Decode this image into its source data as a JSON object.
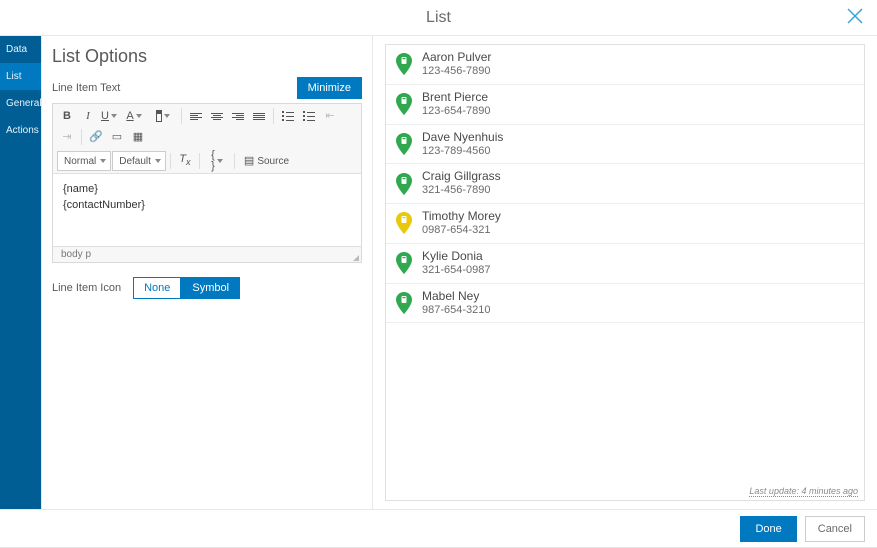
{
  "header": {
    "title": "List"
  },
  "sidenav": {
    "items": [
      {
        "label": "Data",
        "active": false
      },
      {
        "label": "List",
        "active": true
      },
      {
        "label": "General",
        "active": false
      },
      {
        "label": "Actions",
        "active": false
      }
    ]
  },
  "config": {
    "title": "List Options",
    "line_item_text_label": "Line Item Text",
    "minimize_label": "Minimize",
    "editor": {
      "format_select": "Normal",
      "font_select": "Default",
      "source_label": "Source",
      "content": "{name}\n{contactNumber}",
      "footer_path": "body  p"
    },
    "line_item_icon_label": "Line Item Icon",
    "icon_options": {
      "none": "None",
      "symbol": "Symbol"
    }
  },
  "preview": {
    "items": [
      {
        "name": "Aaron Pulver",
        "phone": "123-456-7890",
        "color": "green"
      },
      {
        "name": "Brent Pierce",
        "phone": "123-654-7890",
        "color": "green"
      },
      {
        "name": "Dave Nyenhuis",
        "phone": "123-789-4560",
        "color": "green"
      },
      {
        "name": "Craig Gillgrass",
        "phone": "321-456-7890",
        "color": "green"
      },
      {
        "name": "Timothy Morey",
        "phone": "0987-654-321",
        "color": "yellow"
      },
      {
        "name": "Kylie Donia",
        "phone": "321-654-0987",
        "color": "green"
      },
      {
        "name": "Mabel Ney",
        "phone": "987-654-3210",
        "color": "green"
      }
    ],
    "last_update": "Last update: 4 minutes ago"
  },
  "footer": {
    "done": "Done",
    "cancel": "Cancel"
  },
  "colors": {
    "green": "#2fa84f",
    "yellow": "#e8c90e"
  }
}
